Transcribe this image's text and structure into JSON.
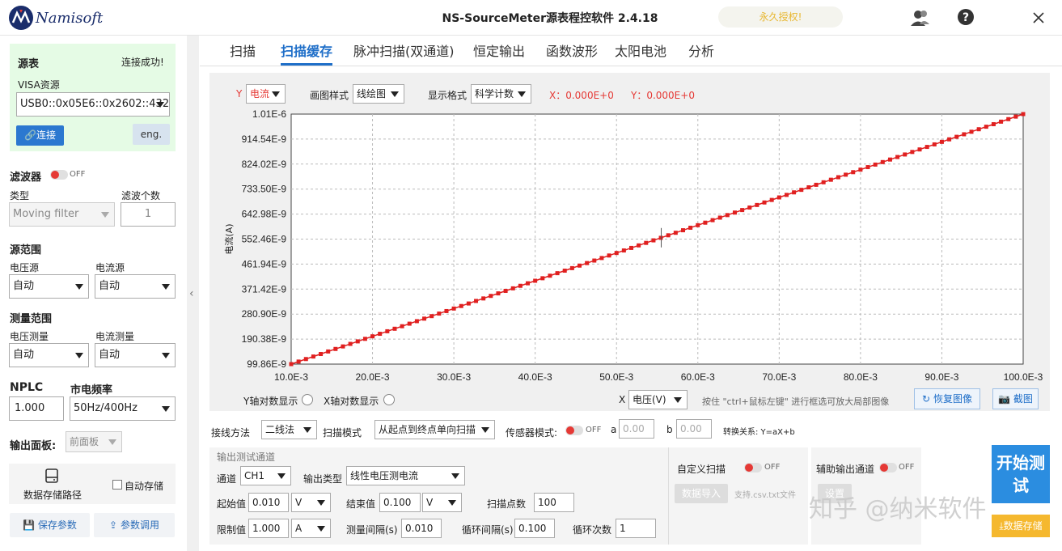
{
  "app": {
    "logo_text": "Namisoft",
    "title": "NS-SourceMeter源表程控软件 2.4.18",
    "license": "永久授权!"
  },
  "source": {
    "heading": "源表",
    "status": "连接成功!",
    "visa_label": "VISA资源",
    "visa_value": "USB0::0x05E6::0x2602::432",
    "connect": "连接",
    "lang": "eng."
  },
  "filter": {
    "heading": "滤波器",
    "toggle": "OFF",
    "type_label": "类型",
    "type_value": "Moving filter",
    "count_label": "滤波个数",
    "count_value": "1"
  },
  "source_range": {
    "heading": "源范围",
    "voltage_label": "电压源",
    "voltage_value": "自动",
    "current_label": "电流源",
    "current_value": "自动"
  },
  "measure_range": {
    "heading": "测量范围",
    "voltage_label": "电压测量",
    "voltage_value": "自动",
    "current_label": "电流测量",
    "current_value": "自动"
  },
  "nplc": {
    "label": "NPLC",
    "value": "1.000",
    "freq_label": "市电频率",
    "freq_value": "50Hz/400Hz"
  },
  "output_panel": {
    "label": "输出面板:",
    "value": "前面板"
  },
  "storage": {
    "path_label": "数据存储路径",
    "auto_save": "自动存储",
    "save_params": "保存参数",
    "load_params": "参数调用"
  },
  "tabs": [
    "扫描",
    "扫描缓存",
    "脉冲扫描(双通道)",
    "恒定输出",
    "函数波形",
    "太阳电池",
    "分析"
  ],
  "chart_controls": {
    "y_label": "Y",
    "y_value": "电流",
    "style_label": "画图样式",
    "style_value": "线绘图",
    "format_label": "显示格式",
    "format_value": "科学计数",
    "x_readout": "X：0.000E+0",
    "y_readout": "Y：0.000E+0",
    "y_log": "Y轴对数显示",
    "x_log": "X轴对数显示",
    "x_label": "X",
    "x_value": "电压(V)",
    "hint": "按住 \"ctrl+鼠标左键\" 进行框选可放大局部图像",
    "restore": "恢复图像",
    "screenshot": "截图"
  },
  "chart_data": {
    "type": "line",
    "ylabel": "电流(A)",
    "xlim": [
      0.01,
      0.1
    ],
    "ylim": [
      9.986e-08,
      1.01e-06
    ],
    "x_ticks": [
      "10.0E-3",
      "20.0E-3",
      "30.0E-3",
      "40.0E-3",
      "50.0E-3",
      "60.0E-3",
      "70.0E-3",
      "80.0E-3",
      "90.0E-3",
      "100.0E-3"
    ],
    "y_ticks": [
      "1.01E-6",
      "914.54E-9",
      "824.02E-9",
      "733.50E-9",
      "642.98E-9",
      "552.46E-9",
      "461.94E-9",
      "371.42E-9",
      "280.90E-9",
      "190.38E-9",
      "99.86E-9"
    ],
    "series": [
      {
        "x_start": 0.01,
        "x_end": 0.1,
        "y_start": 9.986e-08,
        "y_end": 1.01e-06,
        "points": 100,
        "color": "#e02020"
      }
    ],
    "grid": true
  },
  "mode_row": {
    "wiring_label": "接线方法",
    "wiring_value": "二线法",
    "scan_mode_label": "扫描模式",
    "scan_mode_value": "从起点到终点单向扫描",
    "sensor_label": "传感器模式:",
    "sensor_toggle": "OFF",
    "a_label": "a",
    "a_placeholder": "0.00",
    "b_label": "b",
    "b_placeholder": "0.00",
    "relation": "转换关系: Y=aX+b"
  },
  "params": {
    "group_title": "输出测试通道",
    "channel_label": "通道",
    "channel_value": "CH1",
    "output_type_label": "输出类型",
    "output_type_value": "线性电压测电流",
    "start_label": "起始值",
    "start_value": "0.010",
    "start_unit": "V",
    "end_label": "结束值",
    "end_value": "0.100",
    "end_unit": "V",
    "points_label": "扫描点数",
    "points_value": "100",
    "limit_label": "限制值",
    "limit_value": "1.000",
    "limit_unit": "A",
    "interval_label": "测量间隔(s)",
    "interval_value": "0.010",
    "loop_interval_label": "循环间隔(s)",
    "loop_interval_value": "0.100",
    "loop_count_label": "循环次数",
    "loop_count_value": "1"
  },
  "custom_scan": {
    "label": "自定义扫描",
    "toggle": "OFF",
    "import": "数据导入",
    "support": "支持.csv.txt文件"
  },
  "aux": {
    "label": "辅助输出通道",
    "toggle": "OFF",
    "settings": "设置"
  },
  "actions": {
    "start": "开始测试",
    "save_data": "数据存储"
  },
  "watermark": "知乎 @纳米软件"
}
